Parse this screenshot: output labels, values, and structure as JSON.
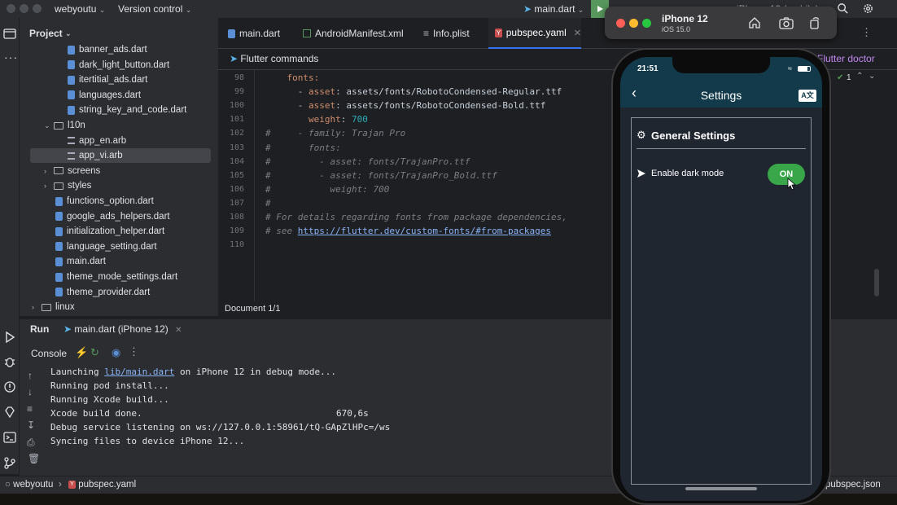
{
  "titlebar": {
    "project_name": "webyoutu",
    "vcs": "Version control",
    "run_config": "main.dart",
    "device": "iPhone 12 (mobile)"
  },
  "project": {
    "header": "Project",
    "tree": [
      {
        "label": "banner_ads.dart",
        "type": "dart",
        "indent": 3
      },
      {
        "label": "dark_light_button.dart",
        "type": "dart",
        "indent": 3
      },
      {
        "label": "itertitial_ads.dart",
        "type": "dart",
        "indent": 3
      },
      {
        "label": "languages.dart",
        "type": "dart",
        "indent": 3
      },
      {
        "label": "string_key_and_code.dart",
        "type": "dart",
        "indent": 3
      },
      {
        "label": "l10n",
        "type": "folder-open",
        "indent": 2
      },
      {
        "label": "app_en.arb",
        "type": "arb",
        "indent": 3
      },
      {
        "label": "app_vi.arb",
        "type": "arb",
        "indent": 3,
        "selected": true
      },
      {
        "label": "screens",
        "type": "folder",
        "indent": 2
      },
      {
        "label": "styles",
        "type": "folder",
        "indent": 2
      },
      {
        "label": "functions_option.dart",
        "type": "dart",
        "indent": 2
      },
      {
        "label": "google_ads_helpers.dart",
        "type": "dart",
        "indent": 2
      },
      {
        "label": "initialization_helper.dart",
        "type": "dart",
        "indent": 2
      },
      {
        "label": "language_setting.dart",
        "type": "dart",
        "indent": 2
      },
      {
        "label": "main.dart",
        "type": "dart",
        "indent": 2
      },
      {
        "label": "theme_mode_settings.dart",
        "type": "dart",
        "indent": 2
      },
      {
        "label": "theme_provider.dart",
        "type": "dart",
        "indent": 2
      },
      {
        "label": "linux",
        "type": "folder",
        "indent": 1
      }
    ]
  },
  "editor": {
    "tabs": [
      {
        "label": "main.dart",
        "icon": "dart-file-icon"
      },
      {
        "label": "AndroidManifest.xml",
        "icon": "xml-file-icon"
      },
      {
        "label": "Info.plist",
        "icon": "plist-file-icon"
      },
      {
        "label": "pubspec.yaml",
        "icon": "yaml-file-icon",
        "active": true
      }
    ],
    "flutter_commands": "Flutter commands",
    "flutter_doctor": "Flutter doctor",
    "warnings_count": "1",
    "lines": [
      {
        "n": "98",
        "parts": [
          [
            "kw",
            "    fonts:"
          ]
        ]
      },
      {
        "n": "99",
        "parts": [
          [
            "txt",
            "      - "
          ],
          [
            "kw",
            "asset"
          ],
          [
            "txt",
            ": "
          ],
          [
            "str",
            "assets/fonts/RobotoCondensed-Regular.ttf"
          ]
        ]
      },
      {
        "n": "100",
        "parts": [
          [
            "txt",
            "      - "
          ],
          [
            "kw",
            "asset"
          ],
          [
            "txt",
            ": "
          ],
          [
            "str",
            "assets/fonts/RobotoCondensed-Bold.ttf"
          ]
        ]
      },
      {
        "n": "101",
        "parts": [
          [
            "kw",
            "        weight"
          ],
          [
            "txt",
            ": "
          ],
          [
            "num",
            "700"
          ]
        ]
      },
      {
        "n": "102",
        "parts": [
          [
            "cmt",
            "#     - family: Trajan Pro"
          ]
        ]
      },
      {
        "n": "103",
        "parts": [
          [
            "cmt",
            "#       fonts:"
          ]
        ]
      },
      {
        "n": "104",
        "parts": [
          [
            "cmt",
            "#         - asset: fonts/TrajanPro.ttf"
          ]
        ]
      },
      {
        "n": "105",
        "parts": [
          [
            "cmt",
            "#         - asset: fonts/TrajanPro_Bold.ttf"
          ]
        ]
      },
      {
        "n": "106",
        "parts": [
          [
            "cmt",
            "#           weight: 700"
          ]
        ]
      },
      {
        "n": "107",
        "parts": [
          [
            "cmt",
            "#"
          ]
        ]
      },
      {
        "n": "108",
        "parts": [
          [
            "cmt",
            "# For details regarding fonts from package dependencies,"
          ]
        ]
      },
      {
        "n": "109",
        "parts": [
          [
            "cmt",
            "# see "
          ],
          [
            "lnk",
            "https://flutter.dev/custom-fonts/#from-packages"
          ]
        ]
      },
      {
        "n": "110",
        "parts": []
      }
    ],
    "document_status": "Document 1/1"
  },
  "run": {
    "tab_label": "Run",
    "config_tab": "main.dart (iPhone 12)",
    "console_label": "Console",
    "output": [
      {
        "text": "Launching ",
        "link": "lib/main.dart",
        "rest": " on iPhone 12 in debug mode..."
      },
      {
        "text": "Running pod install..."
      },
      {
        "text": "Running Xcode build..."
      },
      {
        "text": "Xcode build done.                                    670,6s"
      },
      {
        "text": "Debug service listening on ws://127.0.0.1:58961/tQ-GApZlHPc=/ws"
      },
      {
        "text": "Syncing files to device iPhone 12..."
      }
    ]
  },
  "statusbar": {
    "project": "webyoutu",
    "file": "pubspec.yaml",
    "right_file": "pubspec.json"
  },
  "simulator": {
    "device_name": "iPhone 12",
    "os_version": "iOS 15.0",
    "time": "21:51",
    "app_title": "Settings",
    "section_title": "General Settings",
    "dark_mode_label": "Enable dark mode",
    "toggle_label": "ON",
    "dark_mode_enabled": true
  },
  "colors": {
    "accent": "#3574f0",
    "toggle_on": "#3aa64a",
    "app_bar": "#123a4a",
    "keyword": "#cf8e6d"
  }
}
